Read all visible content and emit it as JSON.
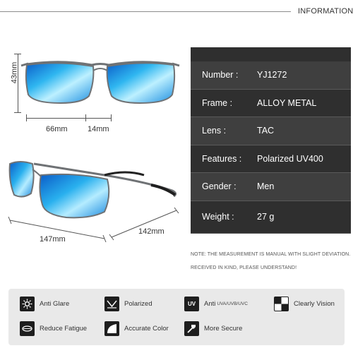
{
  "header": {
    "title": "INFORMATION"
  },
  "dimensions": {
    "lens_height": "43mm",
    "lens_width": "66mm",
    "bridge": "14mm",
    "temple_length": "147mm",
    "frame_width": "142mm"
  },
  "specs": [
    {
      "label": "Number :",
      "value": "YJ1272"
    },
    {
      "label": "Frame :",
      "value": "ALLOY METAL"
    },
    {
      "label": "Lens :",
      "value": "TAC"
    },
    {
      "label": "Features :",
      "value": "Polarized UV400"
    },
    {
      "label": "Gender :",
      "value": "Men"
    },
    {
      "label": "Weight :",
      "value": "27 g"
    }
  ],
  "notes": {
    "line1": "NOTE: THE MEASUREMENT IS MANUAL WITH SLIGHT DEVIATION.",
    "line2": "RECEIVED IN KIND, PLEASE UNDERSTAND!"
  },
  "features": [
    {
      "icon": "anti-glare-icon",
      "label": "Anti Glare",
      "sub": ""
    },
    {
      "icon": "polarized-icon",
      "label": "Polarized",
      "sub": ""
    },
    {
      "icon": "uv-icon",
      "icon_text": "UV",
      "label": "Anti",
      "sub": "UVA/UVB/UVC"
    },
    {
      "icon": "clearly-vision-icon",
      "label": "Clearly Vision",
      "sub": ""
    },
    {
      "icon": "reduce-fatigue-icon",
      "label": "Reduce Fatigue",
      "sub": ""
    },
    {
      "icon": "accurate-color-icon",
      "label": "Accurate Color",
      "sub": ""
    },
    {
      "icon": "more-secure-icon",
      "label": "More Secure",
      "sub": ""
    }
  ],
  "colors": {
    "lens_blue": "#1fa3e8",
    "frame_gray": "#6f7275",
    "table_dark": "#2f2f2f",
    "panel_bg": "#e9e9e9"
  }
}
